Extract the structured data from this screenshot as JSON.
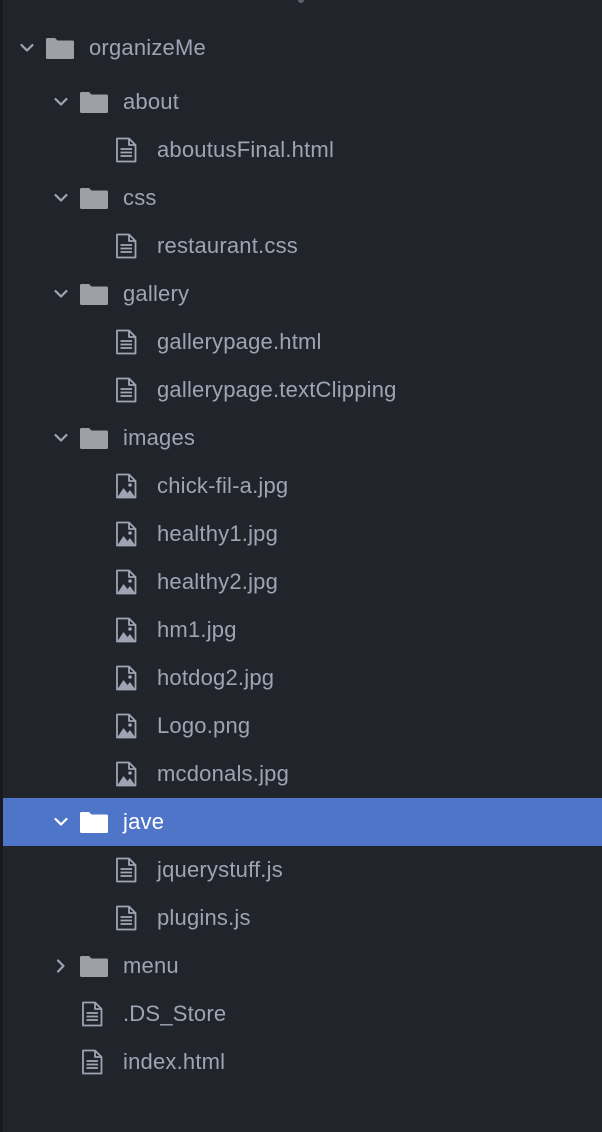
{
  "tree": {
    "root": {
      "label": "organizeMe",
      "icon": "folder-icon",
      "expanded": true
    },
    "about": {
      "label": "about",
      "icon": "folder-icon",
      "expanded": true
    },
    "about_file": {
      "label": "aboutusFinal.html",
      "icon": "file-text-icon"
    },
    "css": {
      "label": "css",
      "icon": "folder-icon",
      "expanded": true
    },
    "css_file": {
      "label": "restaurant.css",
      "icon": "file-text-icon"
    },
    "gallery": {
      "label": "gallery",
      "icon": "folder-icon",
      "expanded": true
    },
    "gallery_file1": {
      "label": "gallerypage.html",
      "icon": "file-text-icon"
    },
    "gallery_file2": {
      "label": "gallerypage.textClipping",
      "icon": "file-text-icon"
    },
    "images": {
      "label": "images",
      "icon": "folder-icon",
      "expanded": true
    },
    "img1": {
      "label": "chick-fil-a.jpg",
      "icon": "image-file-icon"
    },
    "img2": {
      "label": "healthy1.jpg",
      "icon": "image-file-icon"
    },
    "img3": {
      "label": "healthy2.jpg",
      "icon": "image-file-icon"
    },
    "img4": {
      "label": "hm1.jpg",
      "icon": "image-file-icon"
    },
    "img5": {
      "label": "hotdog2.jpg",
      "icon": "image-file-icon"
    },
    "img6": {
      "label": "Logo.png",
      "icon": "image-file-icon"
    },
    "img7": {
      "label": "mcdonals.jpg",
      "icon": "image-file-icon"
    },
    "jave": {
      "label": "jave",
      "icon": "folder-icon",
      "expanded": true,
      "selected": true
    },
    "jave_file1": {
      "label": "jquerystuff.js",
      "icon": "file-text-icon"
    },
    "jave_file2": {
      "label": "plugins.js",
      "icon": "file-text-icon"
    },
    "menu": {
      "label": "menu",
      "icon": "folder-icon",
      "expanded": false
    },
    "ds_store": {
      "label": ".DS_Store",
      "icon": "file-text-icon"
    },
    "index": {
      "label": "index.html",
      "icon": "file-text-icon"
    }
  },
  "colors": {
    "background": "#21252b",
    "text": "#9da5b4",
    "selected_background": "#4f75c9",
    "selected_text": "#ffffff"
  }
}
